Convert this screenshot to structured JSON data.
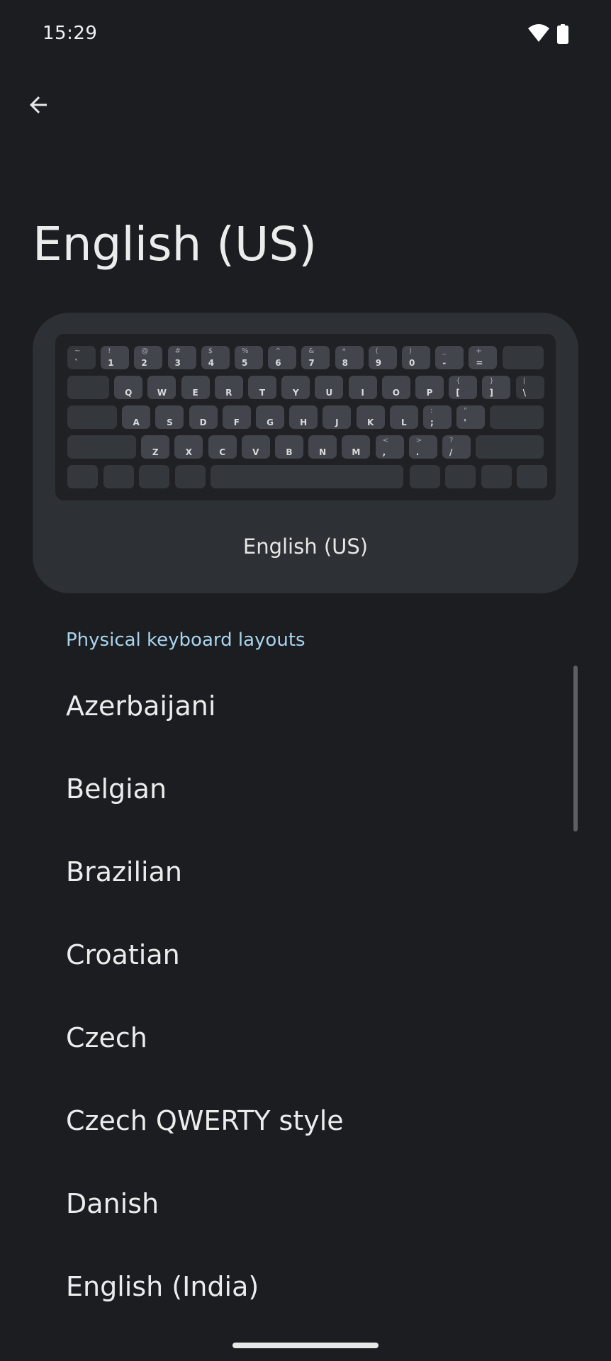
{
  "status_bar": {
    "time": "15:29",
    "wifi_icon": "wifi-icon",
    "battery_icon": "battery-icon"
  },
  "toolbar": {
    "back_icon": "arrow-back-icon"
  },
  "page": {
    "title": "English (US)"
  },
  "preview": {
    "label": "English (US)",
    "keyboard_rows": [
      [
        {
          "top": "~",
          "bottom": "`"
        },
        {
          "top": "!",
          "bottom": "1"
        },
        {
          "top": "@",
          "bottom": "2"
        },
        {
          "top": "#",
          "bottom": "3"
        },
        {
          "top": "$",
          "bottom": "4"
        },
        {
          "top": "%",
          "bottom": "5"
        },
        {
          "top": "^",
          "bottom": "6"
        },
        {
          "top": "&",
          "bottom": "7"
        },
        {
          "top": "*",
          "bottom": "8"
        },
        {
          "top": "(",
          "bottom": "9"
        },
        {
          "top": ")",
          "bottom": "0"
        },
        {
          "top": "_",
          "bottom": "-"
        },
        {
          "top": "+",
          "bottom": "="
        }
      ],
      [
        {
          "main": "Q"
        },
        {
          "main": "W"
        },
        {
          "main": "E"
        },
        {
          "main": "R"
        },
        {
          "main": "T"
        },
        {
          "main": "Y"
        },
        {
          "main": "U"
        },
        {
          "main": "I"
        },
        {
          "main": "O"
        },
        {
          "main": "P"
        },
        {
          "top": "{",
          "bottom": "["
        },
        {
          "top": "}",
          "bottom": "]"
        },
        {
          "top": "|",
          "bottom": "\\"
        }
      ],
      [
        {
          "main": "A"
        },
        {
          "main": "S"
        },
        {
          "main": "D"
        },
        {
          "main": "F"
        },
        {
          "main": "G"
        },
        {
          "main": "H"
        },
        {
          "main": "J"
        },
        {
          "main": "K"
        },
        {
          "main": "L"
        },
        {
          "top": ":",
          "bottom": ";"
        },
        {
          "top": "\"",
          "bottom": "'"
        }
      ],
      [
        {
          "main": "Z"
        },
        {
          "main": "X"
        },
        {
          "main": "C"
        },
        {
          "main": "V"
        },
        {
          "main": "B"
        },
        {
          "main": "N"
        },
        {
          "main": "M"
        },
        {
          "top": "<",
          "bottom": ","
        },
        {
          "top": ">",
          "bottom": "."
        },
        {
          "top": "?",
          "bottom": "/"
        }
      ]
    ]
  },
  "section": {
    "header": "Physical keyboard layouts"
  },
  "layouts": [
    "Azerbaijani",
    "Belgian",
    "Brazilian",
    "Croatian",
    "Czech",
    "Czech QWERTY style",
    "Danish",
    "English (India)"
  ]
}
